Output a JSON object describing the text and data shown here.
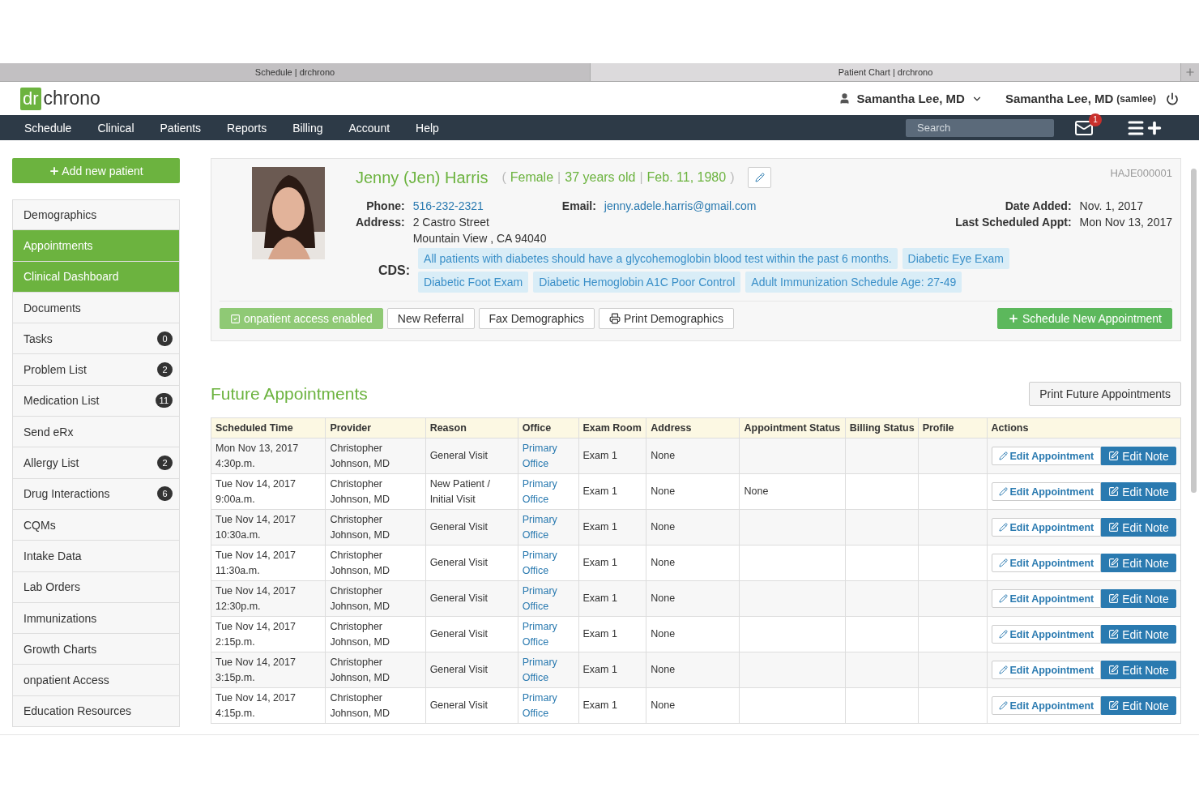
{
  "browser_tabs": [
    {
      "title": "Schedule | drchrono",
      "selected": false
    },
    {
      "title": "Patient Chart | drchrono",
      "selected": true
    }
  ],
  "logo": {
    "mark": "dr",
    "name": "chrono"
  },
  "user_menu": "Samantha Lee, MD",
  "account": {
    "name": "Samantha Lee, MD",
    "username": "(samlee)"
  },
  "nav": [
    "Schedule",
    "Clinical",
    "Patients",
    "Reports",
    "Billing",
    "Account",
    "Help"
  ],
  "search": {
    "placeholder": "Search"
  },
  "messages": {
    "count": "1"
  },
  "sidebar": {
    "add_button": "Add new patient",
    "items": [
      {
        "label": "Demographics",
        "highlighted": false
      },
      {
        "label": "Appointments",
        "highlighted": true
      },
      {
        "label": "Clinical Dashboard",
        "highlighted": true
      },
      {
        "label": "Documents",
        "highlighted": false
      },
      {
        "label": "Tasks",
        "highlighted": false,
        "badge": "0"
      },
      {
        "label": "Problem List",
        "highlighted": false,
        "badge": "2"
      },
      {
        "label": "Medication List",
        "highlighted": false,
        "badge": "11"
      },
      {
        "label": "Send eRx",
        "highlighted": false
      },
      {
        "label": "Allergy List",
        "highlighted": false,
        "badge": "2"
      },
      {
        "label": "Drug Interactions",
        "highlighted": false,
        "badge": "6"
      },
      {
        "label": "CQMs",
        "highlighted": false
      },
      {
        "label": "Intake Data",
        "highlighted": false
      },
      {
        "label": "Lab Orders",
        "highlighted": false
      },
      {
        "label": "Immunizations",
        "highlighted": false
      },
      {
        "label": "Growth Charts",
        "highlighted": false
      },
      {
        "label": "onpatient Access",
        "highlighted": false
      },
      {
        "label": "Education Resources",
        "highlighted": false
      }
    ]
  },
  "patient": {
    "name": "Jenny (Jen) Harris",
    "brackets": [
      "(",
      ")"
    ],
    "separator": "|",
    "facts": [
      "Female",
      "37 years old",
      "Feb. 11, 1980"
    ],
    "chart_id": "HAJE000001",
    "phone": {
      "label": "Phone:",
      "value": "516-232-2321"
    },
    "email": {
      "label": "Email:",
      "value": "jenny.adele.harris@gmail.com"
    },
    "address": {
      "label": "Address:",
      "lines": [
        "2 Castro Street",
        "Mountain View , CA 94040"
      ]
    },
    "date_added": {
      "label": "Date Added:",
      "value": "Nov. 1, 2017"
    },
    "last_appt": {
      "label": "Last Scheduled Appt:",
      "value": "Mon Nov 13, 2017"
    },
    "cds": {
      "label": "CDS:",
      "tags": [
        "All patients with diabetes should have a glycohemoglobin blood test within the past 6 months.",
        "Diabetic Eye Exam",
        "Diabetic Foot Exam",
        "Diabetic Hemoglobin A1C Poor Control",
        "Adult Immunization Schedule Age: 27-49"
      ]
    },
    "buttons": [
      {
        "label": "onpatient access enabled",
        "kind": "status"
      },
      {
        "label": "New Referral",
        "kind": "default"
      },
      {
        "label": "Fax Demographics",
        "kind": "default"
      },
      {
        "label": "Print Demographics",
        "kind": "print"
      },
      {
        "label": "Schedule New Appointment",
        "kind": "primary"
      }
    ]
  },
  "future_appointments": {
    "title": "Future Appointments",
    "print_button": "Print Future Appointments",
    "columns": [
      "Scheduled Time",
      "Provider",
      "Reason",
      "Office",
      "Exam Room",
      "Address",
      "Appointment Status",
      "Billing Status",
      "Profile",
      "Actions"
    ],
    "rows": [
      {
        "time": "Mon Nov 13, 2017 4:30p.m.",
        "provider": "Christopher Johnson, MD",
        "reason": "General Visit",
        "office": "Primary Office",
        "room": "Exam 1",
        "address": "None",
        "status": "",
        "actions": [
          "Edit Appointment",
          "Edit Note"
        ]
      },
      {
        "time": "Tue Nov 14, 2017 9:00a.m.",
        "provider": "Christopher Johnson, MD",
        "reason": "New Patient / Initial Visit",
        "office": "Primary Office",
        "room": "Exam 1",
        "address": "None",
        "status": "None",
        "actions": [
          "Edit Appointment",
          "Edit Note"
        ]
      },
      {
        "time": "Tue Nov 14, 2017 10:30a.m.",
        "provider": "Christopher Johnson, MD",
        "reason": "General Visit",
        "office": "Primary Office",
        "room": "Exam 1",
        "address": "None",
        "status": "",
        "actions": [
          "Edit Appointment",
          "Edit Note"
        ]
      },
      {
        "time": "Tue Nov 14, 2017 11:30a.m.",
        "provider": "Christopher Johnson, MD",
        "reason": "General Visit",
        "office": "Primary Office",
        "room": "Exam 1",
        "address": "None",
        "status": "",
        "actions": [
          "Edit Appointment",
          "Edit Note"
        ]
      },
      {
        "time": "Tue Nov 14, 2017 12:30p.m.",
        "provider": "Christopher Johnson, MD",
        "reason": "General Visit",
        "office": "Primary Office",
        "room": "Exam 1",
        "address": "None",
        "status": "",
        "actions": [
          "Edit Appointment",
          "Edit Note"
        ]
      },
      {
        "time": "Tue Nov 14, 2017 2:15p.m.",
        "provider": "Christopher Johnson, MD",
        "reason": "General Visit",
        "office": "Primary Office",
        "room": "Exam 1",
        "address": "None",
        "status": "",
        "actions": [
          "Edit Appointment",
          "Edit Note"
        ]
      },
      {
        "time": "Tue Nov 14, 2017 3:15p.m.",
        "provider": "Christopher Johnson, MD",
        "reason": "General Visit",
        "office": "Primary Office",
        "room": "Exam 1",
        "address": "None",
        "status": "",
        "actions": [
          "Edit Appointment",
          "Edit Note"
        ]
      },
      {
        "time": "Tue Nov 14, 2017 4:15p.m.",
        "provider": "Christopher Johnson, MD",
        "reason": "General Visit",
        "office": "Primary Office",
        "room": "Exam 1",
        "address": "None",
        "status": "",
        "actions": [
          "Edit Appointment",
          "Edit Note"
        ]
      }
    ]
  }
}
